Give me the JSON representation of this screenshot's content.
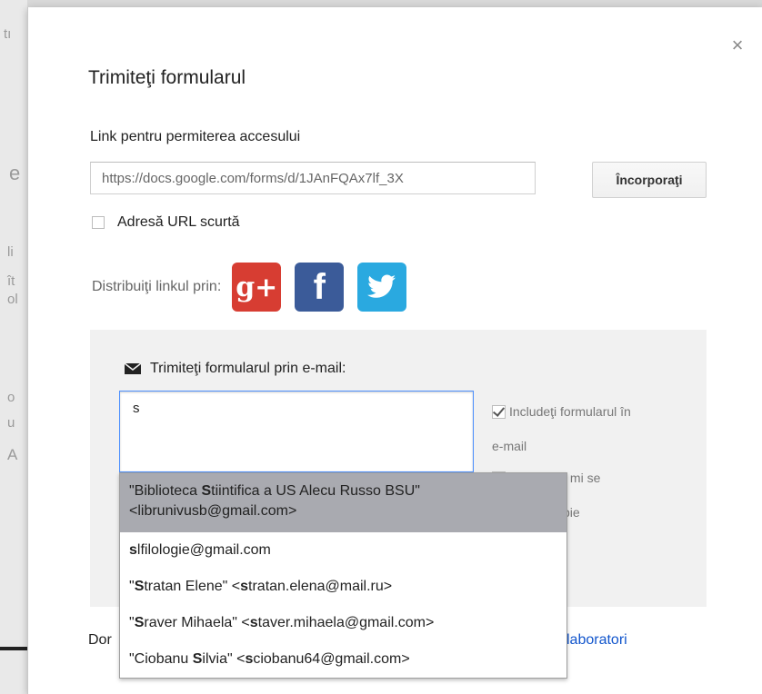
{
  "dialog": {
    "title": "Trimiteţi formularul",
    "close_glyph": "×",
    "link_label": "Link pentru permiterea accesului",
    "url_value": "https://docs.google.com/forms/d/1JAnFQAx7lf_3X",
    "embed_button": "Încorporaţi",
    "short_url_label": "Adresă URL scurtă",
    "share_label": "Distribuiţi linkul prin:",
    "social": {
      "gplus_glyph": "g+",
      "facebook_glyph": "f",
      "twitter_glyph": "🐦"
    }
  },
  "email": {
    "heading": "Trimiteţi formularul prin e-mail:",
    "input_value": "s",
    "include_form_label_1": "Includeţi formularul în",
    "include_form_label_2": "e-mail",
    "copy_label_1": "Doresc să mi se",
    "copy_label_2": "pie"
  },
  "bottom": {
    "left_text": "Dor",
    "right_text": "laboratori"
  },
  "autocomplete": {
    "items": [
      {
        "line1_pre": "\"Biblioteca ",
        "line1_bold": "S",
        "line1_post": "tiintifica a US Alecu Russo BSU\"",
        "line2": "<librunivusb@gmail.com>"
      },
      {
        "bold": "s",
        "rest": "lfilologie@gmail.com"
      },
      {
        "pre": "\"",
        "bold1": "S",
        "mid": "tratan Elene\" <",
        "bold2": "s",
        "rest": "tratan.elena@mail.ru>"
      },
      {
        "pre": "\"",
        "bold1": "S",
        "mid": "raver Mihaela\" <",
        "bold2": "s",
        "rest": "taver.mihaela@gmail.com>"
      },
      {
        "pre": "\"Ciobanu ",
        "bold1": "S",
        "mid": "ilvia\" <",
        "bold2": "s",
        "rest": "ciobanu64@gmail.com>"
      }
    ]
  },
  "background": {
    "letters": [
      "tı",
      "e",
      "li",
      "ît",
      "ol",
      "o",
      "u",
      "A"
    ]
  },
  "colors": {
    "focus_border": "#4d90fe",
    "selected_row": "#a9aab0",
    "gplus": "#d73d32",
    "facebook": "#3b5b99",
    "twitter": "#2aa9e0"
  }
}
